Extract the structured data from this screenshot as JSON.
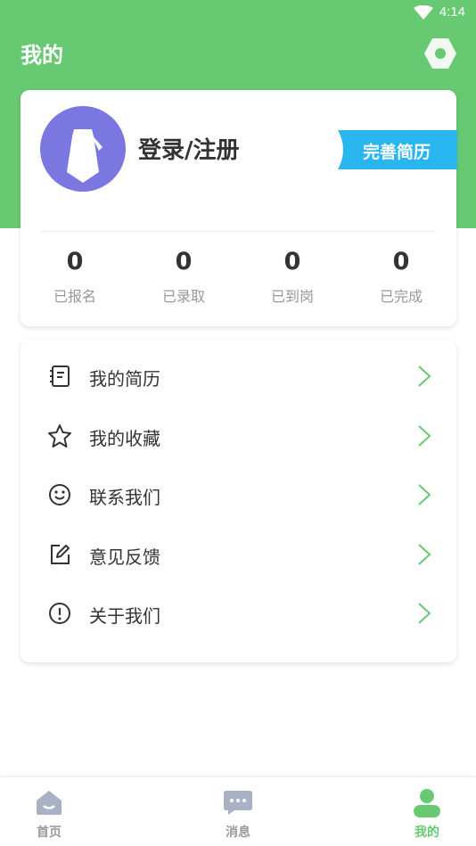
{
  "status_bar": {
    "time": "4:14"
  },
  "header": {
    "title": "我的"
  },
  "profile": {
    "login_label": "登录/注册",
    "complete_resume_label": "完善简历",
    "stats": [
      {
        "value": "0",
        "label": "已报名"
      },
      {
        "value": "0",
        "label": "已录取"
      },
      {
        "value": "0",
        "label": "已到岗"
      },
      {
        "value": "0",
        "label": "已完成"
      }
    ]
  },
  "menu": {
    "items": [
      {
        "label": "我的简历",
        "icon": "resume-icon"
      },
      {
        "label": "我的收藏",
        "icon": "star-icon"
      },
      {
        "label": "联系我们",
        "icon": "smile-icon"
      },
      {
        "label": "意见反馈",
        "icon": "edit-icon"
      },
      {
        "label": "关于我们",
        "icon": "info-icon"
      }
    ]
  },
  "tabbar": {
    "tabs": [
      {
        "label": "首页",
        "icon": "home-icon",
        "active": false
      },
      {
        "label": "消息",
        "icon": "message-icon",
        "active": false
      },
      {
        "label": "我的",
        "icon": "person-icon",
        "active": true
      }
    ]
  },
  "colors": {
    "brand_green": "#67c972",
    "avatar_purple": "#7b77e0",
    "tag_blue": "#29b6f0",
    "inactive_gray": "#999999"
  }
}
